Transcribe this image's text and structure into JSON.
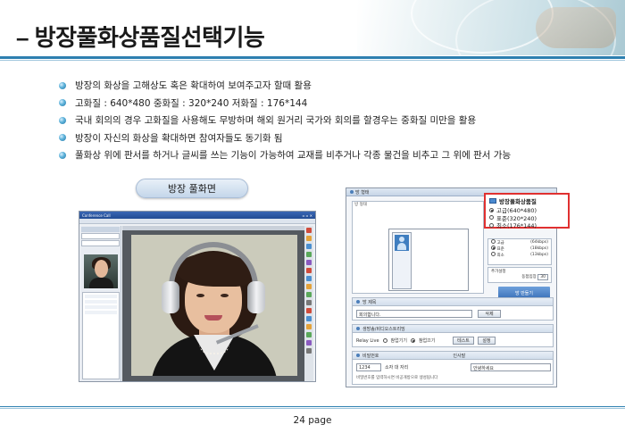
{
  "title": "– 방장풀화상품질선택기능",
  "bullets": [
    "방장의 화상을 고해상도 혹은 확대하여 보여주고자 할때 활용",
    "고화질 : 640*480  중화질 : 320*240  저화질 : 176*144",
    "국내 회의의 경우 고화질을 사용해도 무방하며 해외 원거리 국가와 회의를 할경우는 중화질 미만을 활용",
    "방장이 자신의 화상을 확대하면 참여자들도 동기화 됨",
    "풀화상 위에 판서를 하거나 글씨를 쓰는 기능이 가능하여 교재를 비추거나 각종 물건을 비추고 그 위에 판서 가능"
  ],
  "pill_label": "방장 풀화면",
  "screenshot_left": {
    "window_title": "Conference Call"
  },
  "screenshot_right": {
    "room_header": "방 형태",
    "quality_box": {
      "title": "방장풀화상품질",
      "options": [
        "고급(640*480)",
        "표준(320*240)",
        "최소(176*144)"
      ],
      "selected": 0
    },
    "bandwidth_options": [
      {
        "label": "고급",
        "value": "(64kbps)"
      },
      {
        "label": "표준",
        "value": "(18kbps)"
      },
      {
        "label": "최소",
        "value": "(13kbps)"
      }
    ],
    "extra_setting_label": "추가설정",
    "entry_label": "동접입장",
    "entry_value": "30",
    "make_room_button": "방 만들기",
    "room_title_label": "방 제목",
    "room_title_value": "회의합니다.",
    "delete_button": "삭제",
    "broadcast_label": "생방송/비디오스트리밍",
    "relay_label": "Relay Live",
    "relay_options": [
      "참업기기",
      "참업끄기"
    ],
    "test_button": "테스트",
    "setting_button": "설정",
    "password_label": "비밀번호",
    "password_value": "1234",
    "seat_label": "소자 대 자리",
    "greeting_label": "인사말",
    "greeting_value": "안녕하세요",
    "hint_text": "비밀번호를 입력하시면 비공개방으로 생성됩니다"
  },
  "page_number": "24 page",
  "colors": {
    "accent": "#2d7fb0",
    "highlight": "#e03030",
    "button_blue": "#3a70b8"
  }
}
